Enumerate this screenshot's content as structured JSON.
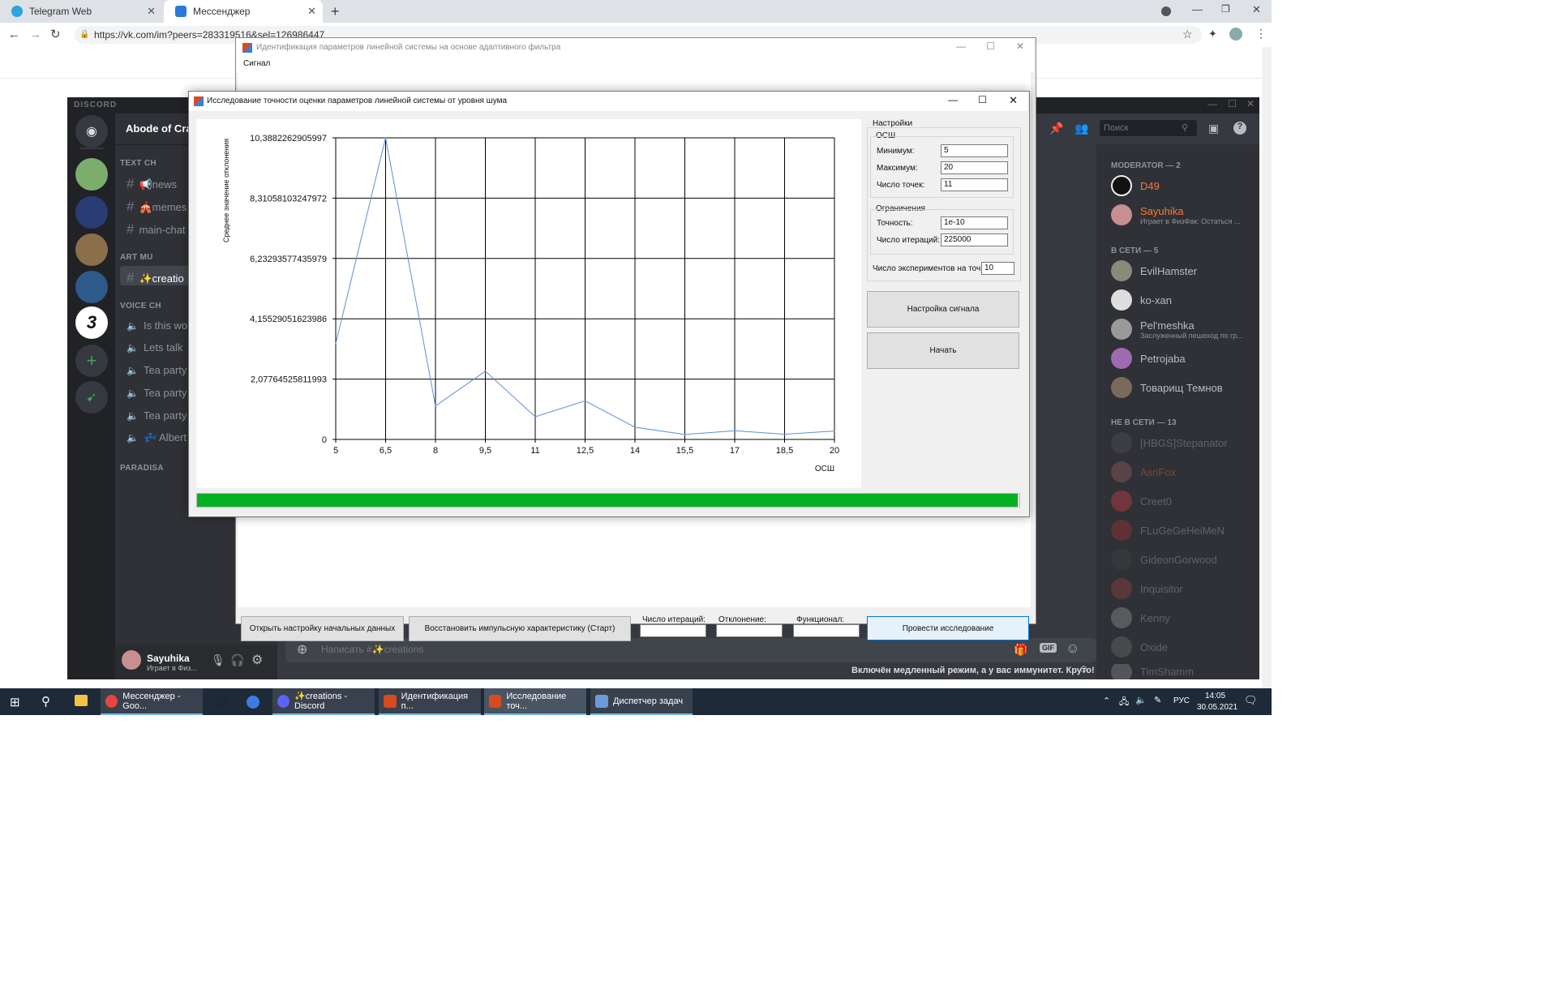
{
  "browser": {
    "tabs": [
      {
        "label": "Telegram Web"
      },
      {
        "label": "Мессенджер"
      }
    ],
    "url": "https://vk.com/im?peers=283319516&sel=126986447"
  },
  "discord": {
    "logo": "DISCORD",
    "server_name": "Abode of Crab",
    "server_badge": "3",
    "categories": [
      "TEXT CH",
      "ART MU",
      "VOICE CH",
      "PARADISA"
    ],
    "channels": [
      {
        "label": "news",
        "emoji": "📢"
      },
      {
        "label": "memes",
        "emoji": "🎪"
      },
      {
        "label": "main-chat",
        "emoji": ""
      },
      {
        "label": "creatio",
        "emoji": "✨"
      }
    ],
    "voice_channels": [
      "Is this wor",
      "Lets talk",
      "Tea party",
      "Tea party",
      "Tea party",
      "Albert"
    ],
    "voice_emoji": "💤",
    "user": {
      "name": "Sayuhika",
      "status": "Играет в Физ..."
    },
    "search_placeholder": "Поиск",
    "message_placeholder": "Написать #✨creations",
    "slowmode_notice": "Включён медленный режим, а у вас иммунитет. Круто!",
    "member_groups": [
      {
        "title": "MODERATOR — 2",
        "members": [
          {
            "name": "D49",
            "color": "#f47b37",
            "sub": ""
          },
          {
            "name": "Sayuhika",
            "color": "#f47b37",
            "sub": "Играет в ФизФак: Остаться ..."
          }
        ]
      },
      {
        "title": "В СЕТИ — 5",
        "members": [
          {
            "name": "EvilHamster",
            "color": "#b9bbbe",
            "sub": ""
          },
          {
            "name": "ko-xan",
            "color": "#b9bbbe",
            "sub": ""
          },
          {
            "name": "Pel'meshka",
            "color": "#b9bbbe",
            "sub": "Заслуженный пешеход по гр..."
          },
          {
            "name": "Petrojaba",
            "color": "#b9bbbe",
            "sub": ""
          },
          {
            "name": "Товарищ Темнов",
            "color": "#b9bbbe",
            "sub": ""
          }
        ]
      },
      {
        "title": "НЕ В СЕТИ — 13",
        "members": [
          {
            "name": "[HBGS]Stepanator"
          },
          {
            "name": "AsriFox"
          },
          {
            "name": "Creet0"
          },
          {
            "name": "FLuGeGeHeiMeN"
          },
          {
            "name": "GideonGorwood"
          },
          {
            "name": "Inquisitor"
          },
          {
            "name": "Kenny"
          },
          {
            "name": "Oxide"
          },
          {
            "name": "TimShamm"
          }
        ]
      }
    ]
  },
  "main_window": {
    "title": "Идентификация параметров линейной системы на основе адаптивного фильтра",
    "menu": "Сигнал",
    "buttons": {
      "open_settings": "Открыть настройку начальных данных",
      "restore": "Восстановить импульсную характеристику (Старт)",
      "research": "Провести исследование"
    },
    "fields": {
      "iterations": "Число итераций:",
      "deviation": "Отклонение:",
      "functional": "Функционал:"
    }
  },
  "dialog": {
    "title": "Исследование точности оценки параметров линейной системы от уровня шума",
    "settings": {
      "group": "Настройки",
      "osh": "ОСШ",
      "min_label": "Минимум:",
      "min_value": "5",
      "max_label": "Максимум:",
      "max_value": "20",
      "points_label": "Число точек:",
      "points_value": "11",
      "limits": "Ограничения",
      "precision_label": "Точность:",
      "precision_value": "1e-10",
      "iter_label": "Число итераций:",
      "iter_value": "225000",
      "experiments_label": "Число экспериментов на точку:",
      "experiments_value": "10"
    },
    "buttons": {
      "signal_setup": "Настройка сигнала",
      "start": "Начать"
    },
    "progress": 1.0
  },
  "chart_data": {
    "type": "line",
    "title": "",
    "xlabel": "ОСШ",
    "ylabel": "Среднее значение отклонения",
    "x": [
      5,
      6.5,
      8,
      9.5,
      11,
      12.5,
      14,
      15.5,
      17,
      18.5,
      20
    ],
    "series": [
      {
        "values": [
          3.3,
          10.3882262905997,
          1.15,
          2.35,
          0.78,
          1.33,
          0.42,
          0.17,
          0.3,
          0.18,
          0.29
        ],
        "color": "#5b8fd8"
      }
    ],
    "xlim": [
      5,
      20
    ],
    "ylim": [
      0,
      10.3882262905997
    ],
    "xticks": [
      "5",
      "6,5",
      "8",
      "9,5",
      "11",
      "12,5",
      "14",
      "15,5",
      "17",
      "18,5",
      "20"
    ],
    "yticks": [
      "0",
      "2,07764525811993",
      "4,15529051623986",
      "6,23293577435979",
      "8,31058103247972",
      "10,3882262905997"
    ],
    "grid": true
  },
  "taskbar": {
    "items": [
      {
        "label": "Мессенджер - Goo...",
        "color": "#e8453c"
      },
      {
        "label": "",
        "color": "#1b2838"
      },
      {
        "label": "",
        "color": "#3d7be0"
      },
      {
        "label": "✨creations - Discord",
        "color": "#5865f2"
      },
      {
        "label": "Идентификация п...",
        "color": "#d84b20"
      },
      {
        "label": "Исследование точ...",
        "color": "#d84b20"
      },
      {
        "label": "Диспетчер задач",
        "color": "#6a9bd8"
      }
    ],
    "lang": "РУС",
    "time": "14:05",
    "date": "30.05.2021"
  }
}
